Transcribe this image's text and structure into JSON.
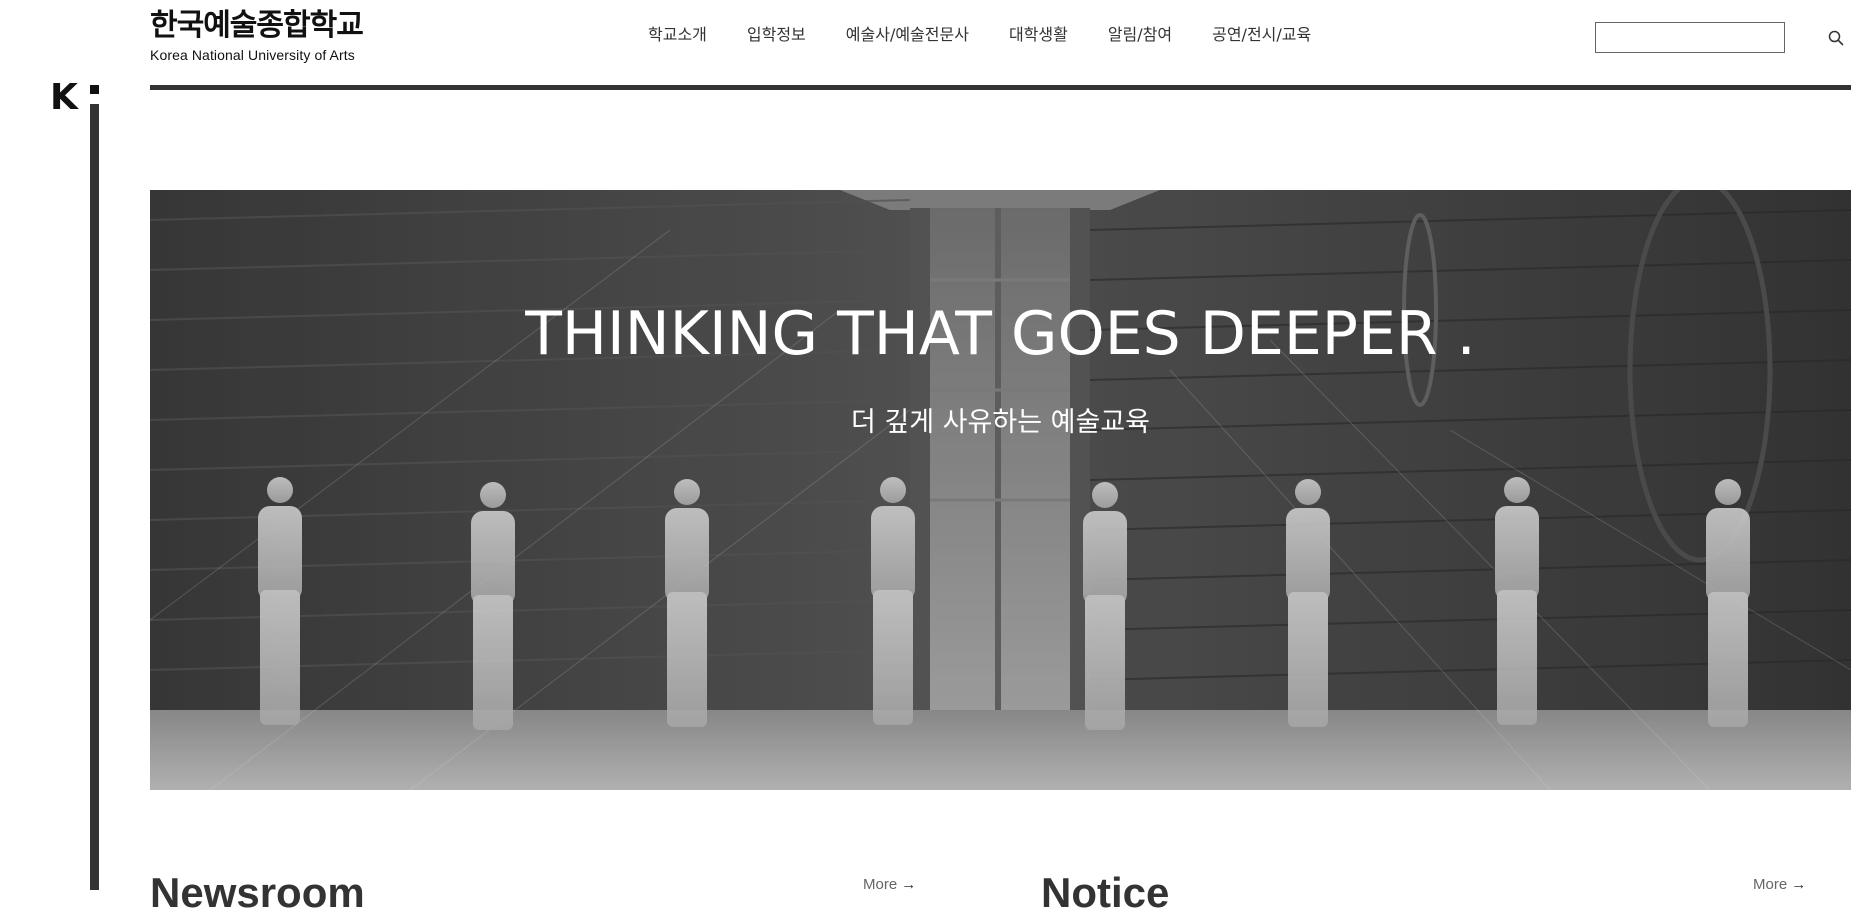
{
  "brand": {
    "korean_name": "한국예술종합학교",
    "english_name": "Korea National University of Arts",
    "side_logo_letter": "K"
  },
  "nav": {
    "items": [
      {
        "label": "학교소개"
      },
      {
        "label": "입학정보"
      },
      {
        "label": "예술사/예술전문사"
      },
      {
        "label": "대학생활"
      },
      {
        "label": "알림/참여"
      },
      {
        "label": "공연/전시/교육"
      }
    ]
  },
  "search": {
    "value": "",
    "placeholder": "",
    "icon": "search-icon"
  },
  "hero": {
    "title": "THINKING THAT GOES DEEPER .",
    "subtitle": "더 깊게 사유하는 예술교육"
  },
  "sections": {
    "newsroom": {
      "heading": "Newsroom",
      "more_label": "More",
      "more_icon": "arrow-right-icon"
    },
    "notice": {
      "heading": "Notice",
      "more_label": "More",
      "more_icon": "arrow-right-icon"
    }
  },
  "colors": {
    "rule": "#333333",
    "hero_overlay": "#4a4a4a",
    "text": "#333333",
    "hero_text": "#ffffff"
  }
}
